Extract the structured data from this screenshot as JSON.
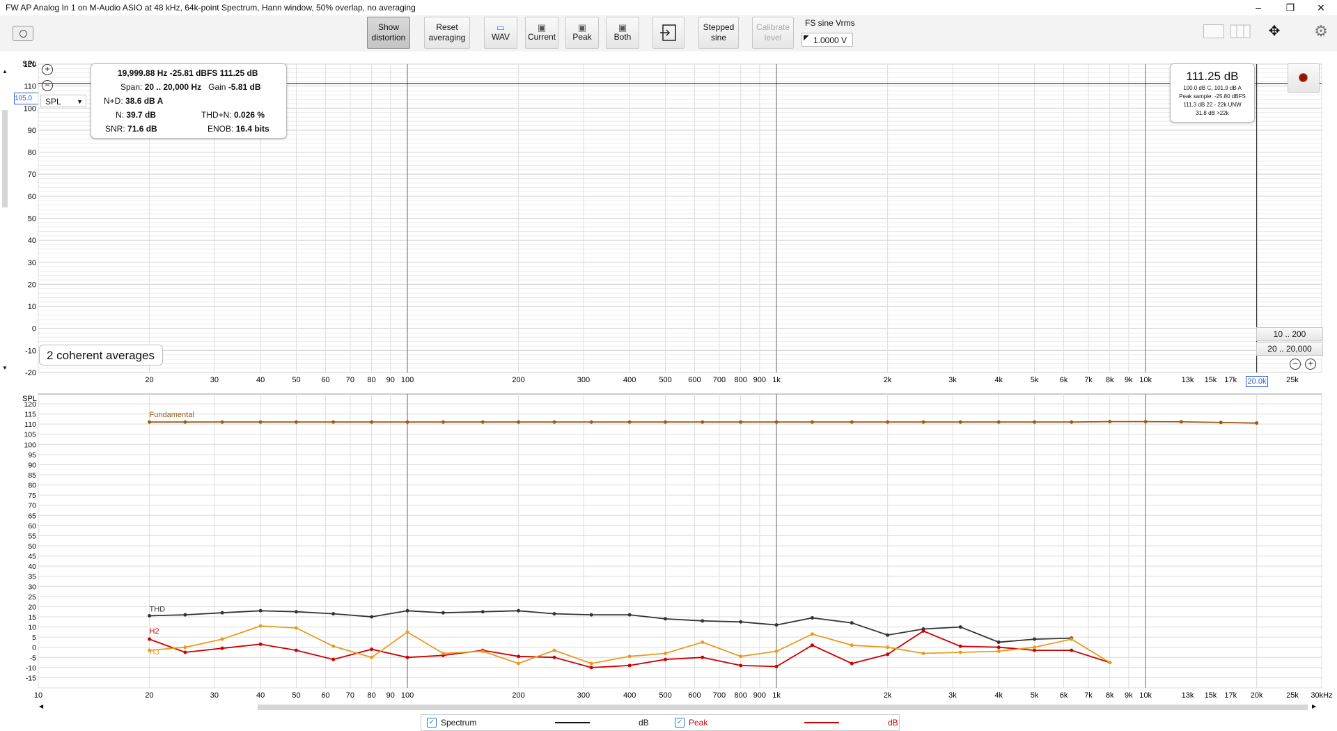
{
  "window": {
    "title": "FW AP Analog In 1 on M-Audio ASIO at 48 kHz, 64k-point Spectrum, Hann window, 50% overlap, no averaging",
    "controls": [
      "–",
      "❐",
      "✕"
    ]
  },
  "toolbar": {
    "show_distortion": [
      "Show",
      "distortion"
    ],
    "reset_averaging": [
      "Reset",
      "averaging"
    ],
    "wav": "WAV",
    "current": "Current",
    "peak": "Peak",
    "both": "Both",
    "stepped_sine": [
      "Stepped",
      "sine"
    ],
    "calibrate_level": [
      "Calibrate",
      "level"
    ],
    "fs_label": "FS sine Vrms",
    "fs_value": "1.0000 V"
  },
  "top_panel": {
    "spl_label": "SPL",
    "spl_select": "SPL",
    "level_marker": "105.0",
    "cursor": {
      "line1": "19,999.88 Hz  -25.81 dBFS  111.25 dB",
      "span_label": "Span:",
      "span_value": "20 .. 20,000 Hz",
      "gain_label": "Gain",
      "gain_value": "-5.81 dB",
      "nd_label": "N+D:",
      "nd_value": "38.6 dB A",
      "n_label": "N:",
      "n_value": "39.7 dB",
      "thdn_label": "THD+N:",
      "thdn_value": "0.026 %",
      "snr_label": "SNR:",
      "snr_value": "71.6 dB",
      "enob_label": "ENOB:",
      "enob_value": "16.4 bits"
    },
    "level_box": {
      "main": "111.25 dB",
      "l1": "100.0 dB C, 101.9 dB A",
      "l2": "Peak sample: -25.80 dBFS",
      "l3": "111.3 dB 22 - 22k UNW",
      "l4": "31.8 dB >22k"
    },
    "averages": "2 coherent averages",
    "range_buttons": [
      "10 .. 200",
      "20 .. 20,000"
    ],
    "freq_readout": "20.0k",
    "y_ticks": [
      "120",
      "110",
      "100",
      "90",
      "80",
      "70",
      "60",
      "50",
      "40",
      "30",
      "20",
      "10",
      "0",
      "-10",
      "-20"
    ],
    "x_ticks": [
      {
        "f": 20,
        "l": "20"
      },
      {
        "f": 30,
        "l": "30"
      },
      {
        "f": 40,
        "l": "40"
      },
      {
        "f": 50,
        "l": "50"
      },
      {
        "f": 60,
        "l": "60"
      },
      {
        "f": 70,
        "l": "70"
      },
      {
        "f": 80,
        "l": "80"
      },
      {
        "f": 90,
        "l": "90"
      },
      {
        "f": 100,
        "l": "100"
      },
      {
        "f": 200,
        "l": "200"
      },
      {
        "f": 300,
        "l": "300"
      },
      {
        "f": 400,
        "l": "400"
      },
      {
        "f": 500,
        "l": "500"
      },
      {
        "f": 600,
        "l": "600"
      },
      {
        "f": 700,
        "l": "700"
      },
      {
        "f": 800,
        "l": "800"
      },
      {
        "f": 900,
        "l": "900"
      },
      {
        "f": 1000,
        "l": "1k"
      },
      {
        "f": 2000,
        "l": "2k"
      },
      {
        "f": 3000,
        "l": "3k"
      },
      {
        "f": 4000,
        "l": "4k"
      },
      {
        "f": 5000,
        "l": "5k"
      },
      {
        "f": 6000,
        "l": "6k"
      },
      {
        "f": 7000,
        "l": "7k"
      },
      {
        "f": 8000,
        "l": "8k"
      },
      {
        "f": 9000,
        "l": "9k"
      },
      {
        "f": 10000,
        "l": "10k"
      },
      {
        "f": 13000,
        "l": "13k"
      },
      {
        "f": 15000,
        "l": "15k"
      },
      {
        "f": 17000,
        "l": "17k"
      },
      {
        "f": 25000,
        "l": "25k"
      }
    ]
  },
  "chart_data": {
    "type": "line",
    "title": "",
    "xlabel": "",
    "ylabel": "SPL",
    "x_scale": "log",
    "xlim": [
      10,
      30000
    ],
    "ylim": [
      -20,
      120
    ],
    "x_ticks": [
      {
        "f": 10,
        "l": "10"
      },
      {
        "f": 20,
        "l": "20"
      },
      {
        "f": 30,
        "l": "30"
      },
      {
        "f": 40,
        "l": "40"
      },
      {
        "f": 50,
        "l": "50"
      },
      {
        "f": 60,
        "l": "60"
      },
      {
        "f": 70,
        "l": "70"
      },
      {
        "f": 80,
        "l": "80"
      },
      {
        "f": 90,
        "l": "90"
      },
      {
        "f": 100,
        "l": "100"
      },
      {
        "f": 200,
        "l": "200"
      },
      {
        "f": 300,
        "l": "300"
      },
      {
        "f": 400,
        "l": "400"
      },
      {
        "f": 500,
        "l": "500"
      },
      {
        "f": 600,
        "l": "600"
      },
      {
        "f": 700,
        "l": "700"
      },
      {
        "f": 800,
        "l": "800"
      },
      {
        "f": 900,
        "l": "900"
      },
      {
        "f": 1000,
        "l": "1k"
      },
      {
        "f": 2000,
        "l": "2k"
      },
      {
        "f": 3000,
        "l": "3k"
      },
      {
        "f": 4000,
        "l": "4k"
      },
      {
        "f": 5000,
        "l": "5k"
      },
      {
        "f": 6000,
        "l": "6k"
      },
      {
        "f": 7000,
        "l": "7k"
      },
      {
        "f": 8000,
        "l": "8k"
      },
      {
        "f": 9000,
        "l": "9k"
      },
      {
        "f": 10000,
        "l": "10k"
      },
      {
        "f": 13000,
        "l": "13k"
      },
      {
        "f": 15000,
        "l": "15k"
      },
      {
        "f": 17000,
        "l": "17k"
      },
      {
        "f": 20000,
        "l": "20k"
      },
      {
        "f": 25000,
        "l": "25k"
      },
      {
        "f": 30000,
        "l": "30kHz"
      }
    ],
    "y_ticks": [
      120,
      115,
      110,
      105,
      100,
      95,
      90,
      85,
      80,
      75,
      70,
      65,
      60,
      55,
      50,
      45,
      40,
      35,
      30,
      25,
      20,
      15,
      10,
      5,
      0,
      -5,
      -10,
      -15
    ],
    "grid": true,
    "series": [
      {
        "name": "Fundamental",
        "color": "#9c5a14",
        "x": [
          20,
          25,
          31.5,
          40,
          50,
          63,
          80,
          100,
          125,
          160,
          200,
          250,
          315,
          400,
          500,
          630,
          800,
          1000,
          1250,
          1600,
          2000,
          2500,
          3150,
          4000,
          5000,
          6300,
          8000,
          10000,
          12500,
          16000,
          20000
        ],
        "y": [
          111,
          111,
          111,
          111,
          111,
          111,
          111,
          111,
          111,
          111,
          111,
          111,
          111,
          111,
          111,
          111,
          111,
          111,
          111,
          111,
          111,
          111,
          111,
          111,
          111,
          111,
          111.2,
          111.2,
          111.1,
          110.8,
          110.5
        ]
      },
      {
        "name": "THD",
        "color": "#333333",
        "x": [
          20,
          25,
          31.5,
          40,
          50,
          63,
          80,
          100,
          125,
          160,
          200,
          250,
          315,
          400,
          500,
          630,
          800,
          1000,
          1250,
          1600,
          2000,
          2500,
          3150,
          4000,
          5000,
          6300
        ],
        "y": [
          15.5,
          16,
          17,
          18,
          17.5,
          16.5,
          15,
          18,
          17,
          17.5,
          18,
          16.5,
          16,
          16,
          14,
          13,
          12.5,
          11,
          14.5,
          12,
          6,
          9,
          10,
          2.5,
          4,
          4.5
        ]
      },
      {
        "name": "H2",
        "color": "#cc0000",
        "x": [
          20,
          25,
          31.5,
          40,
          50,
          63,
          80,
          100,
          125,
          160,
          200,
          250,
          315,
          400,
          500,
          630,
          800,
          1000,
          1250,
          1600,
          2000,
          2500,
          3150,
          4000,
          5000,
          6300,
          8000
        ],
        "y": [
          4,
          -2.5,
          -0.5,
          1.5,
          -1.5,
          -6,
          -1,
          -5,
          -4,
          -1.5,
          -4.5,
          -5,
          -10,
          -9,
          -6,
          -5,
          -9,
          -9.5,
          1,
          -8,
          -3.5,
          8,
          0.5,
          0,
          -1.5,
          -1.5,
          -7.5
        ]
      },
      {
        "name": "H3",
        "color": "#e89b1e",
        "x": [
          20,
          25,
          31.5,
          40,
          50,
          63,
          80,
          100,
          125,
          160,
          200,
          250,
          315,
          400,
          500,
          630,
          800,
          1000,
          1250,
          1600,
          2000,
          2500,
          3150,
          4000,
          5000,
          6300,
          8000
        ],
        "y": [
          -1.5,
          0,
          4,
          10.5,
          9.5,
          0.5,
          -5,
          7.5,
          -3,
          -2,
          -8,
          -1.5,
          -8,
          -4.5,
          -3,
          2.5,
          -4.5,
          -2,
          6.5,
          1,
          0,
          -3,
          -2.5,
          -2,
          0,
          4,
          -7.5
        ]
      }
    ]
  },
  "legend": {
    "spectrum": "Spectrum",
    "spectrum_unit": "dB",
    "peak": "Peak",
    "peak_unit": "dB"
  }
}
